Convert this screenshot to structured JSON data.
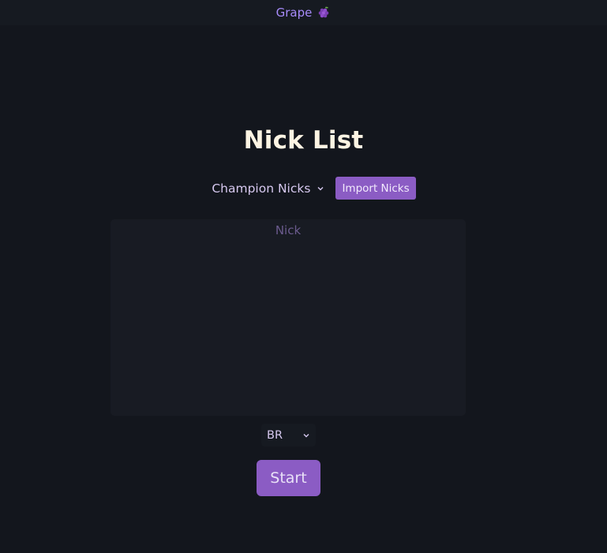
{
  "header": {
    "brand": "Grape",
    "brand_icon": "grape-icon"
  },
  "page": {
    "title": "Nick List"
  },
  "controls": {
    "list_selected": "Champion Nicks",
    "import_label": "Import Nicks"
  },
  "nick_input": {
    "placeholder": "Nick"
  },
  "region": {
    "selected": "BR"
  },
  "start_label": "Start",
  "colors": {
    "background": "#13161d",
    "accent": "#8b5cc4",
    "brand": "#a78bfa",
    "title": "#fdf4e3"
  }
}
